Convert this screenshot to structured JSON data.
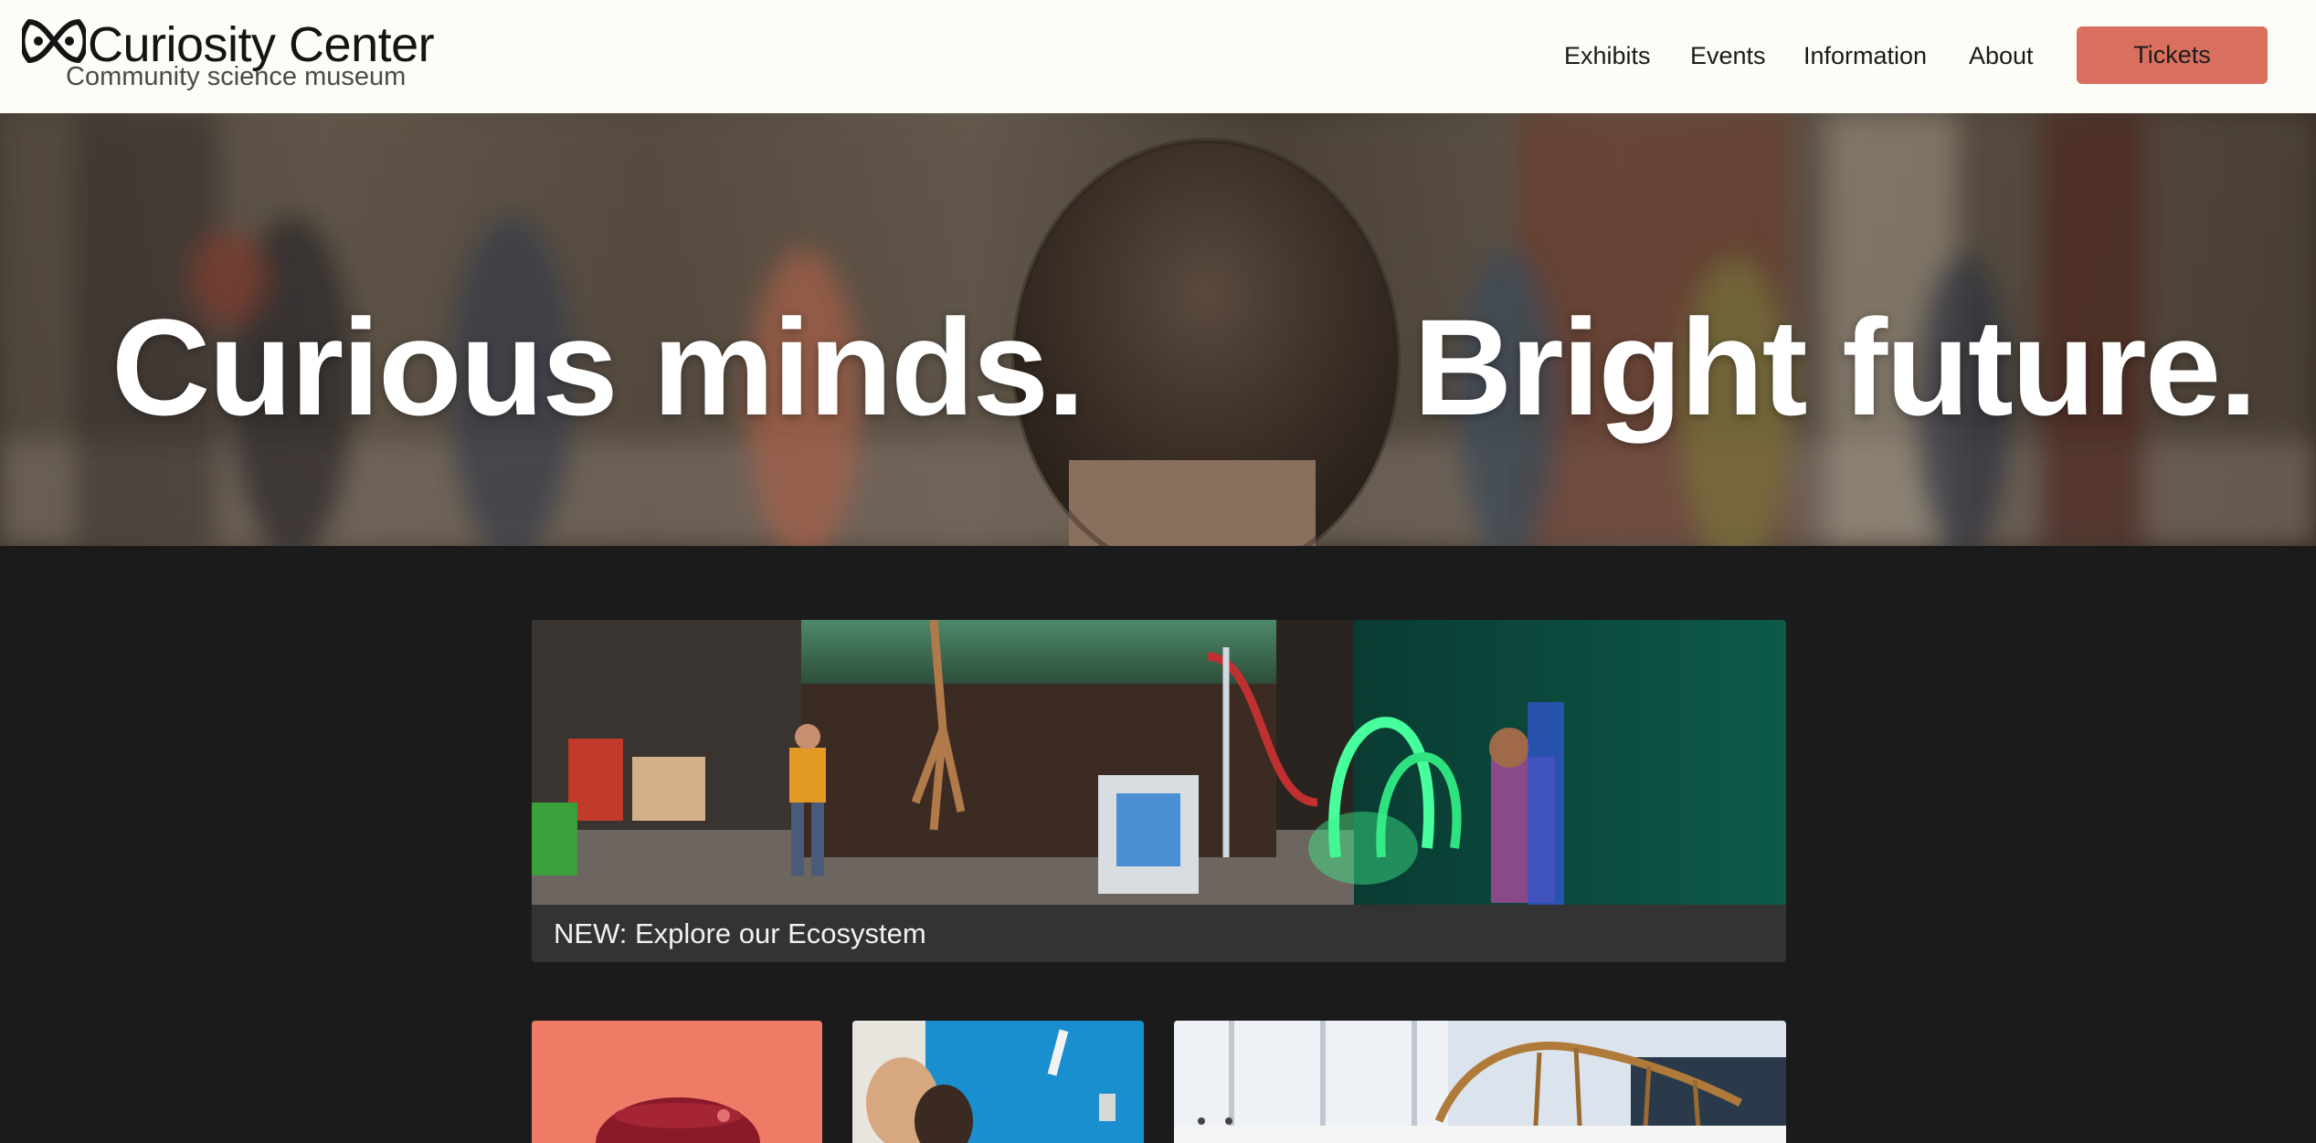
{
  "brand": {
    "name": "Curiosity Center",
    "tagline": "Community science museum",
    "logo_icon": "atom-knot-icon"
  },
  "nav": {
    "items": [
      {
        "label": "Exhibits"
      },
      {
        "label": "Events"
      },
      {
        "label": "Information"
      },
      {
        "label": "About"
      }
    ],
    "cta_label": "Tickets"
  },
  "hero": {
    "headline_left": "Curious minds.",
    "headline_right": "Bright future."
  },
  "feature": {
    "caption": "NEW: Explore our Ecosystem"
  },
  "colors": {
    "header_bg": "#fdfcf6",
    "page_bg": "#1b1b1b",
    "accent": "#d9705f",
    "caption_bg": "#333333"
  }
}
